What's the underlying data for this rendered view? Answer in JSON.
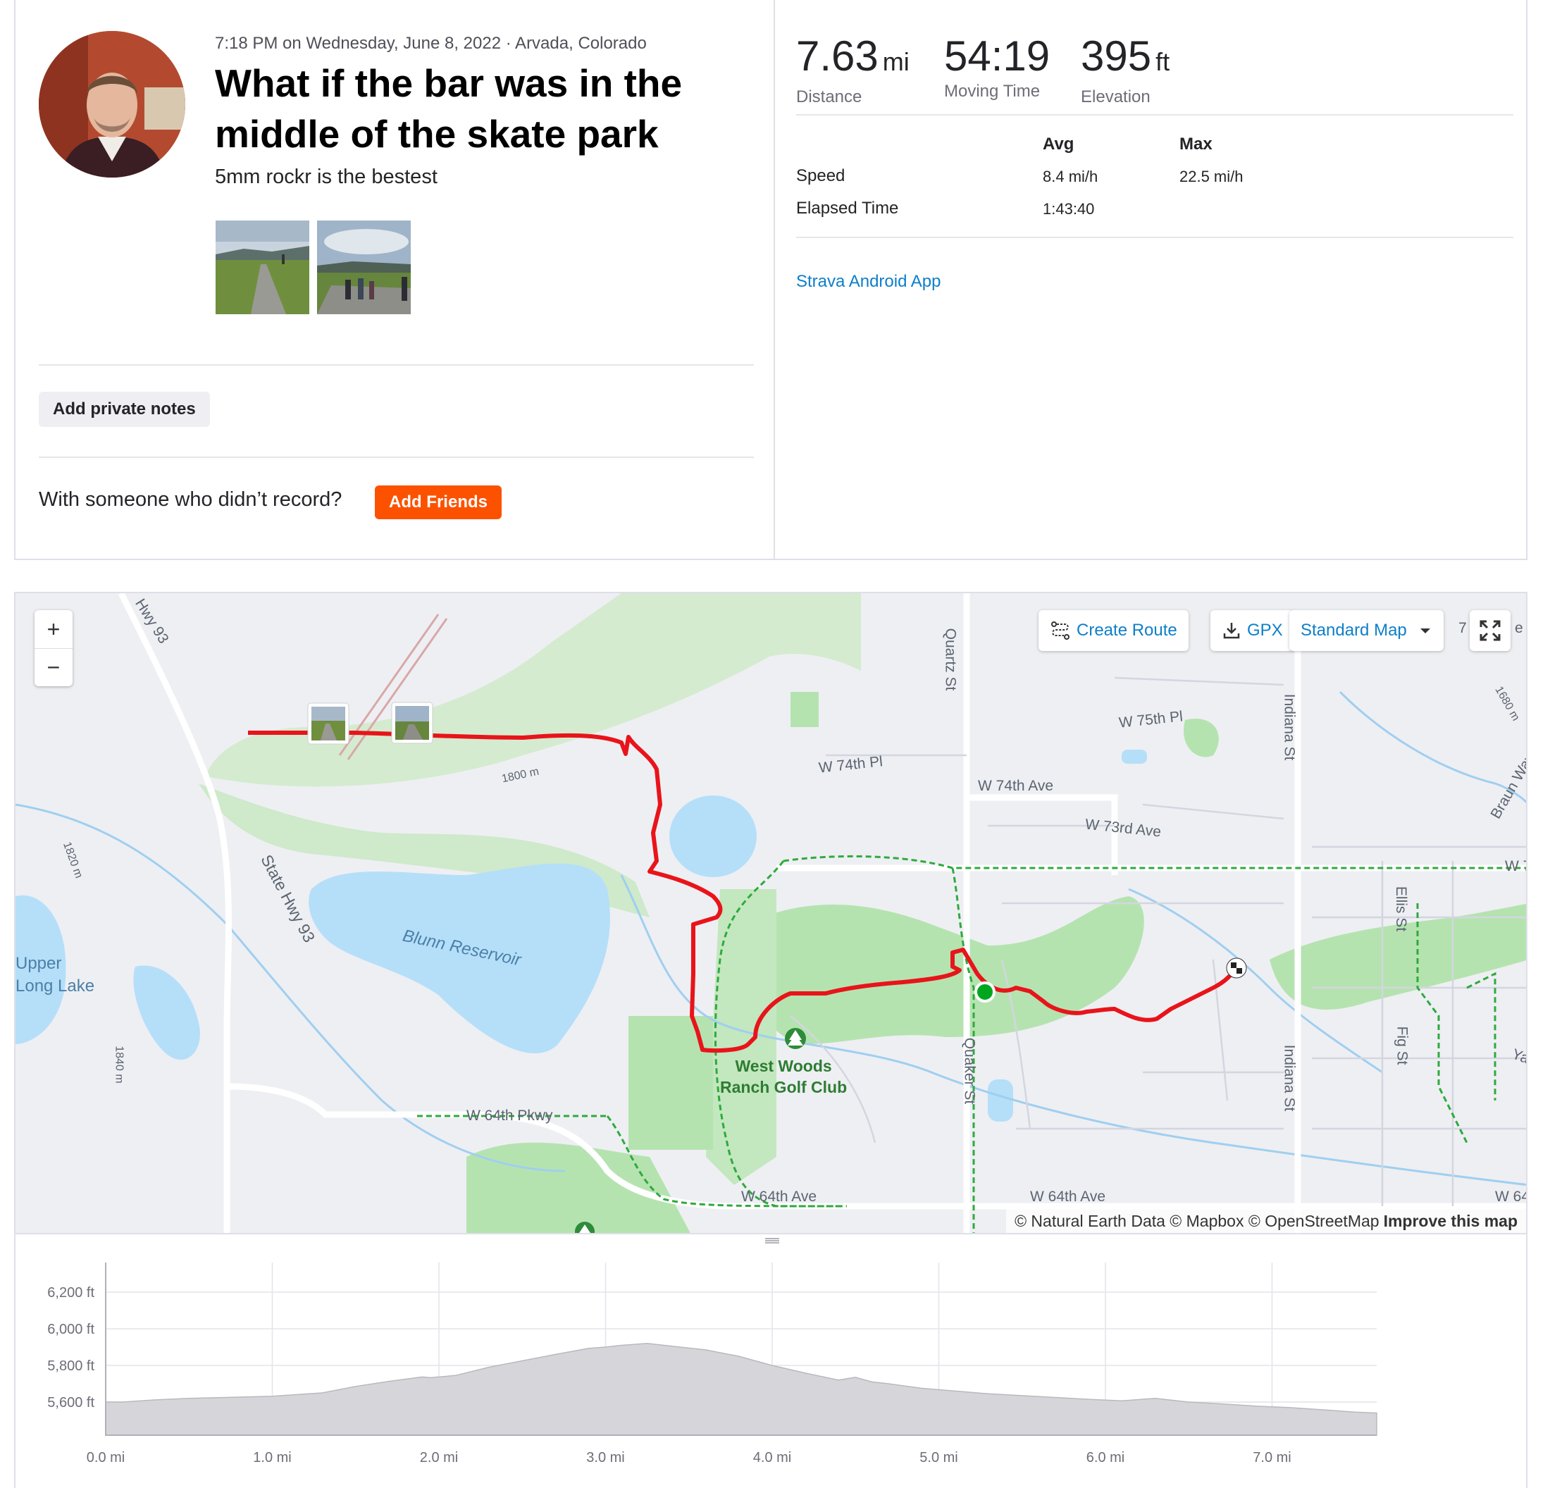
{
  "activity": {
    "meta": "7:18 PM on Wednesday, June 8, 2022 · Arvada, Colorado",
    "title": "What if the bar was in the middle of the skate park",
    "description": "5mm rockr is the bestest",
    "add_notes_label": "Add private notes",
    "with_someone_text": "With someone who didn’t record?",
    "add_friends_label": "Add Friends",
    "device": "Strava Android App"
  },
  "stats": {
    "distance": {
      "value": "7.63",
      "unit": "mi",
      "label": "Distance"
    },
    "moving_time": {
      "value": "54:19",
      "label": "Moving Time"
    },
    "elevation": {
      "value": "395",
      "unit": "ft",
      "label": "Elevation"
    },
    "table": {
      "col_avg": "Avg",
      "col_max": "Max",
      "rows": [
        {
          "label": "Speed",
          "avg": "8.4 mi/h",
          "max": "22.5 mi/h"
        },
        {
          "label": "Elapsed Time",
          "avg": "1:43:40",
          "max": ""
        }
      ]
    }
  },
  "map": {
    "controls": {
      "zoom_in": "+",
      "zoom_out": "−",
      "create_route": "Create Route",
      "gpx": "GPX",
      "map_style": "Standard Map"
    },
    "labels": {
      "hwy93": "Hwy 93",
      "state_hwy93": "State Hwy 93",
      "blunn": "Blunn Reservoir",
      "upper_long_lake": "Upper\nLong Lake",
      "c1820": "1820 m",
      "c1840": "1840 m",
      "c1800": "1800 m",
      "c1680": "1680 m",
      "quartz": "Quartz St",
      "w75pl": "W 75th Pl",
      "w74pl": "W 74th Pl",
      "w74ave": "W 74th Ave",
      "w73ave": "W 73rd Ave",
      "indiana1": "Indiana St",
      "indiana2": "Indiana St",
      "braun": "Braun Way",
      "w7": "W 7",
      "ellis": "Ellis St",
      "fig": "Fig St",
      "ya": "Ya",
      "quaker": "Quaker St",
      "w64pkwy": "W 64th Pkwy",
      "w64ave_a": "W 64th Ave",
      "w64ave_b": "W 64th Ave",
      "w64_edge": "W 64",
      "golf": "West Woods\nRanch Golf Club",
      "corner7": "7",
      "corner_e": "e"
    },
    "attribution": "© Natural Earth Data © Mapbox © OpenStreetMap",
    "improve": "Improve this map",
    "colors": {
      "route": "#e8141a",
      "park": "#b5e3b0",
      "water": "#b5dff9",
      "trail": "#2eaa3d",
      "start": "#00a71e"
    }
  },
  "elevation_chart": {
    "type": "area",
    "x_ticks": [
      "0.0 mi",
      "1.0 mi",
      "2.0 mi",
      "3.0 mi",
      "4.0 mi",
      "5.0 mi",
      "6.0 mi",
      "7.0 mi"
    ],
    "y_ticks": [
      "6,200 ft",
      "6,000 ft",
      "5,800 ft",
      "5,600 ft"
    ],
    "xlim": [
      0,
      7.63
    ],
    "ylim": [
      5600,
      6200
    ],
    "x": [
      0,
      0.1,
      0.3,
      0.5,
      0.8,
      1.0,
      1.3,
      1.5,
      1.7,
      1.9,
      1.95,
      2.1,
      2.3,
      2.5,
      2.7,
      2.9,
      3.0,
      3.1,
      3.25,
      3.4,
      3.6,
      3.8,
      4.0,
      4.2,
      4.4,
      4.5,
      4.6,
      4.7,
      4.9,
      5.1,
      5.3,
      5.5,
      5.7,
      5.9,
      6.1,
      6.3,
      6.5,
      6.7,
      6.9,
      7.1,
      7.3,
      7.5,
      7.63
    ],
    "y": [
      5600,
      5600,
      5612,
      5620,
      5627,
      5632,
      5650,
      5685,
      5713,
      5737,
      5733,
      5745,
      5790,
      5825,
      5860,
      5893,
      5900,
      5910,
      5920,
      5905,
      5885,
      5850,
      5800,
      5758,
      5720,
      5735,
      5710,
      5700,
      5675,
      5660,
      5645,
      5635,
      5625,
      5615,
      5607,
      5620,
      5600,
      5590,
      5578,
      5570,
      5558,
      5545,
      5540
    ]
  }
}
